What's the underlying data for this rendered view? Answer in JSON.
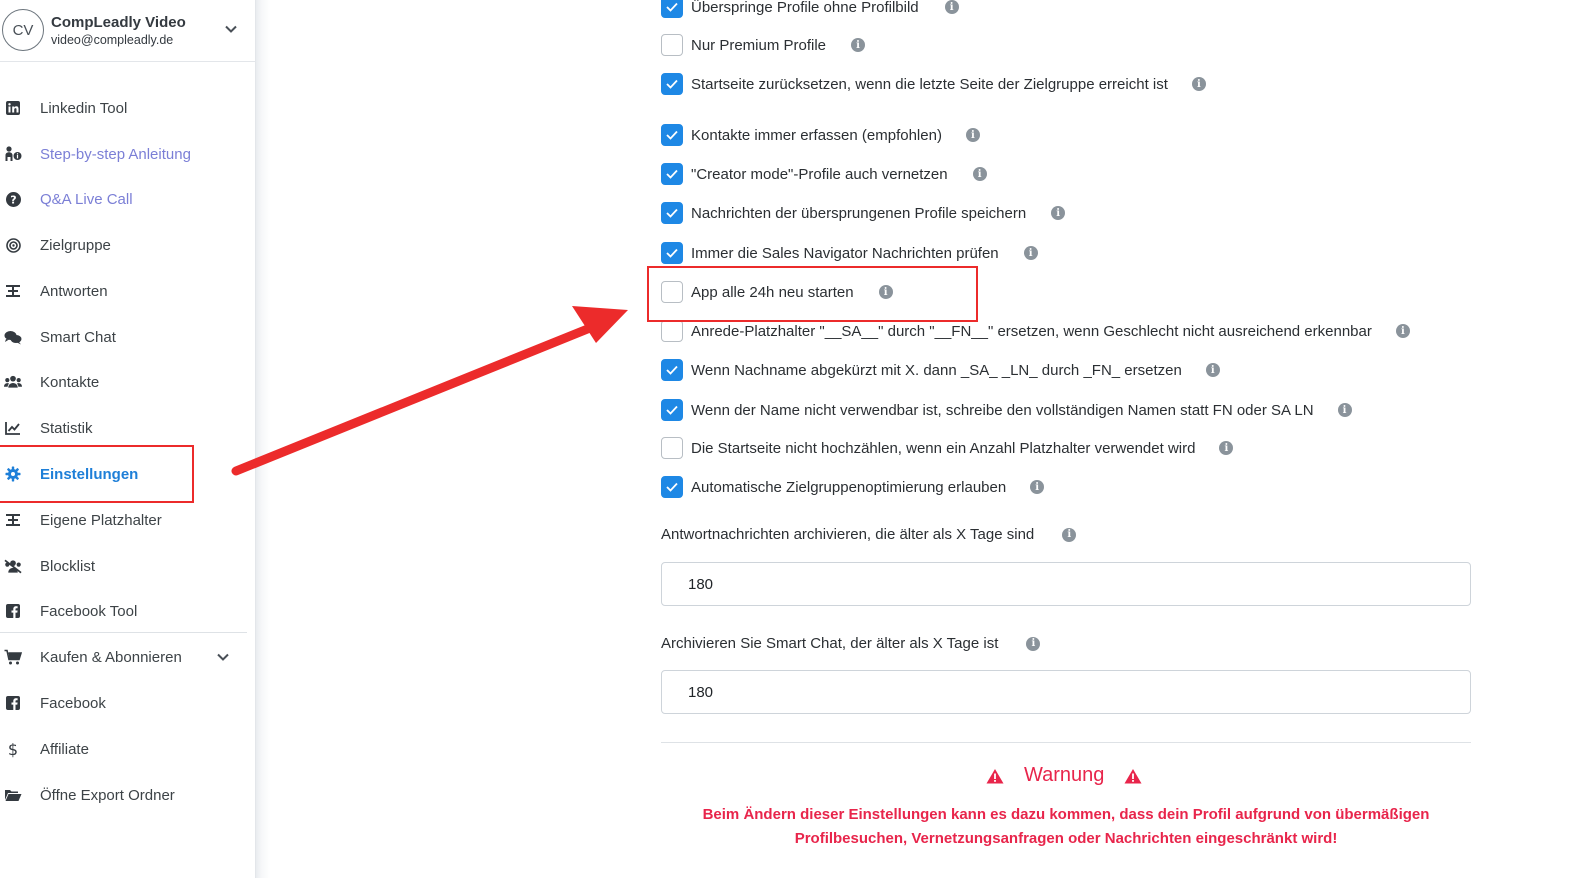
{
  "profile": {
    "initials": "CV",
    "name": "CompLeadly Video",
    "email": "video@compleadly.de"
  },
  "sidebar": {
    "items": [
      {
        "label": "Linkedin Tool",
        "icon": "linkedin-icon"
      },
      {
        "label": "Step-by-step Anleitung",
        "icon": "person-info-icon"
      },
      {
        "label": "Q&A Live Call",
        "icon": "question-circle-icon"
      },
      {
        "label": "Zielgruppe",
        "icon": "target-icon"
      },
      {
        "label": "Antworten",
        "icon": "reply-placeholder-icon"
      },
      {
        "label": "Smart Chat",
        "icon": "chat-bubbles-icon"
      },
      {
        "label": "Kontakte",
        "icon": "users-icon"
      },
      {
        "label": "Statistik",
        "icon": "line-chart-icon"
      },
      {
        "label": "Einstellungen",
        "icon": "gear-icon"
      },
      {
        "label": "Eigene Platzhalter",
        "icon": "placeholder-icon"
      },
      {
        "label": "Blocklist",
        "icon": "users-slash-icon"
      },
      {
        "label": "Facebook Tool",
        "icon": "facebook-icon"
      },
      {
        "label": "Kaufen & Abonnieren",
        "icon": "cart-icon"
      },
      {
        "label": "Facebook",
        "icon": "facebook-icon"
      },
      {
        "label": "Affiliate",
        "icon": "dollar-icon"
      },
      {
        "label": "Öffne Export Ordner",
        "icon": "folder-open-icon"
      }
    ]
  },
  "settings": {
    "checkboxes": [
      {
        "label": "Überspringe Profile ohne Profilbild",
        "checked": true
      },
      {
        "label": "Nur Premium Profile",
        "checked": false
      },
      {
        "label": "Startseite zurücksetzen, wenn die letzte Seite der Zielgruppe erreicht ist",
        "checked": true
      },
      {
        "label": "Kontakte immer erfassen (empfohlen)",
        "checked": true
      },
      {
        "label": "\"Creator mode\"-Profile auch vernetzen",
        "checked": true
      },
      {
        "label": "Nachrichten der übersprungenen Profile speichern",
        "checked": true
      },
      {
        "label": "Immer die Sales Navigator Nachrichten prüfen",
        "checked": true
      },
      {
        "label": "App alle 24h neu starten",
        "checked": false
      },
      {
        "label": "Anrede-Platzhalter \"__SA__\" durch \"__FN__\" ersetzen, wenn Geschlecht nicht ausreichend erkennbar",
        "checked": false
      },
      {
        "label": "Wenn Nachname abgekürzt mit X. dann _SA_ _LN_ durch _FN_ ersetzen",
        "checked": true
      },
      {
        "label": "Wenn der Name nicht verwendbar ist, schreibe den vollständigen Namen statt FN oder SA LN",
        "checked": true
      },
      {
        "label": "Die Startseite nicht hochzählen, wenn ein Anzahl Platzhalter verwendet wird",
        "checked": false
      },
      {
        "label": "Automatische Zielgruppenoptimierung erlauben",
        "checked": true
      }
    ],
    "archive_replies": {
      "label": "Antwortnachrichten archivieren, die älter als X Tage sind",
      "value": "180"
    },
    "archive_smartchat": {
      "label": "Archivieren Sie Smart Chat, der älter als X Tage ist",
      "value": "180"
    },
    "warning": {
      "title": "Warnung",
      "text": "Beim Ändern dieser Einstellungen kann es dazu kommen, dass dein Profil aufgrund von übermäßigen Profilbesuchen, Vernetzungsanfragen oder Nachrichten eingeschränkt wird!"
    }
  },
  "colors": {
    "accent": "#1e88e5",
    "active_nav": "#1e7fd8",
    "link_nav": "#7b7fd6",
    "warning": "#e8254b",
    "annotation": "#ec2b2b"
  }
}
